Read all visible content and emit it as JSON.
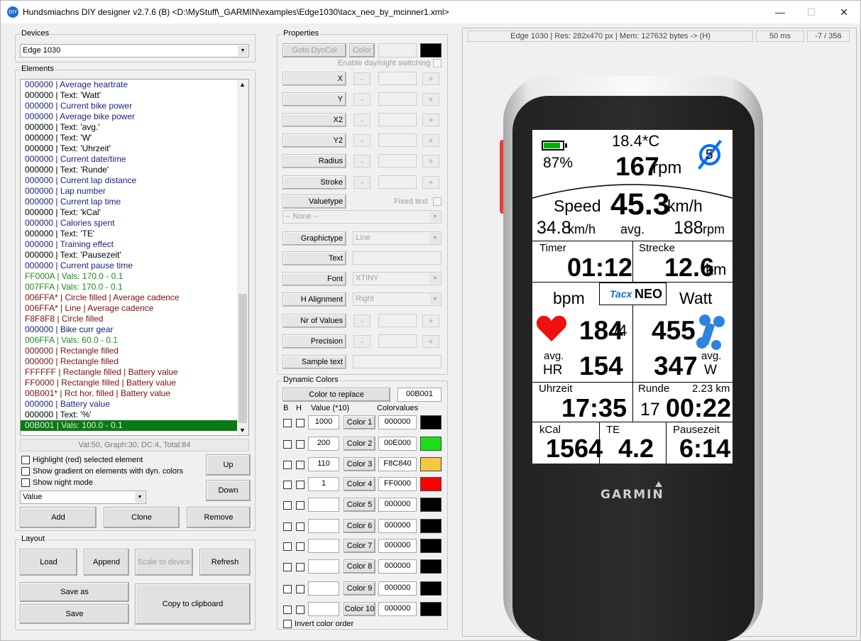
{
  "window": {
    "title": "Hundsmiachns DIY designer v2.7.6 (B) <D:\\MyStuff\\_GARMIN\\examples\\Edge1030\\tacx_neo_by_mcinner1.xml>",
    "icon": "app-icon",
    "min": "—",
    "max": "☐",
    "close": "✕"
  },
  "devices": {
    "label": "Devices",
    "selected": "Edge 1030"
  },
  "elements": {
    "label": "Elements",
    "items": [
      {
        "t": "000000 | Average heartrate",
        "c": "#1a237e"
      },
      {
        "t": "000000 | Text: 'Watt'",
        "c": "#000000"
      },
      {
        "t": "000000 | Current bike power",
        "c": "#1a237e"
      },
      {
        "t": "000000 | Average bike power",
        "c": "#1a237e"
      },
      {
        "t": "000000 | Text: 'avg.'",
        "c": "#000000"
      },
      {
        "t": "000000 | Text: 'W'",
        "c": "#000000"
      },
      {
        "t": "000000 | Text: 'Uhrzeit'",
        "c": "#000000"
      },
      {
        "t": "000000 | Current date/time",
        "c": "#1a237e"
      },
      {
        "t": "000000 | Text: 'Runde'",
        "c": "#000000"
      },
      {
        "t": "000000 | Current lap distance",
        "c": "#1a237e"
      },
      {
        "t": "000000 | Lap number",
        "c": "#1a237e"
      },
      {
        "t": "000000 | Current lap time",
        "c": "#1a237e"
      },
      {
        "t": "000000 | Text: 'kCal'",
        "c": "#000000"
      },
      {
        "t": "000000 | Calories spent",
        "c": "#1a237e"
      },
      {
        "t": "000000 | Text: 'TE'",
        "c": "#000000"
      },
      {
        "t": "000000 | Training effect",
        "c": "#1a237e"
      },
      {
        "t": "000000 | Text: 'Pausezeit'",
        "c": "#000000"
      },
      {
        "t": "000000 | Current pause time",
        "c": "#1a237e"
      },
      {
        "t": "FF000A | Vals: 170.0 - 0.1",
        "c": "#1b8a1b"
      },
      {
        "t": "007FFA | Vals: 170.0 - 0.1",
        "c": "#1b8a1b"
      },
      {
        "t": "006FFA* | Circle filled | Average cadence",
        "c": "#7b1010"
      },
      {
        "t": "006FFA* | Line | Average cadence",
        "c": "#7b1010"
      },
      {
        "t": "F8F8F8 | Circle filled",
        "c": "#7b1010"
      },
      {
        "t": "000000 | Bike curr gear",
        "c": "#1a237e"
      },
      {
        "t": "006FFA | Vals: 60.0 - 0.1",
        "c": "#1b8a1b"
      },
      {
        "t": "000000 | Rectangle filled",
        "c": "#7b1010"
      },
      {
        "t": "000000 | Rectangle filled",
        "c": "#7b1010"
      },
      {
        "t": "FFFFFF | Rectangle filled | Battery value",
        "c": "#7b1010"
      },
      {
        "t": "FF0000 | Rectangle filled | Battery value",
        "c": "#7b1010"
      },
      {
        "t": "00B001* | Rct hor. filled | Battery value",
        "c": "#7b1010"
      },
      {
        "t": "000000 | Battery value",
        "c": "#1a237e"
      },
      {
        "t": "000000 | Text: '%'",
        "c": "#000000"
      },
      {
        "t": "00B001 | Vals: 100.0 - 0.1",
        "c": "#e8e8e8"
      }
    ],
    "summary": "Val:50, Graph:30, DC:4, Total:84",
    "opt_highlight": "Highlight (red) selected element",
    "opt_gradient": "Show gradient on elements with dyn. colors",
    "opt_night": "Show night mode",
    "up": "Up",
    "down": "Down",
    "type_select": "Value",
    "add": "Add",
    "clone": "Clone",
    "remove": "Remove"
  },
  "layout": {
    "label": "Layout",
    "load": "Load",
    "append": "Append",
    "scale": "Scale to device",
    "refresh": "Refresh",
    "save_as": "Save as",
    "save": "Save",
    "copy": "Copy to clipboard"
  },
  "properties": {
    "label": "Properties",
    "goto": "Goto DynCol",
    "color": "Color",
    "daynight": "Enable day/night switching",
    "rows": [
      "X",
      "Y",
      "X2",
      "Y2",
      "Radius",
      "Stroke"
    ],
    "valuetype": "Valuetype",
    "fixedtext": "Fixed text",
    "none": "-- None --",
    "graphictype": "Graphictype",
    "graphic_val": "Line",
    "text": "Text",
    "font": "Font",
    "font_val": "XTINY",
    "halign": "H Alignment",
    "halign_val": "Right",
    "nrvals": "Nr of Values",
    "precision": "Precision",
    "sample": "Sample text",
    "minus": "-",
    "plus": "+"
  },
  "dyncolors": {
    "label": "Dynamic Colors",
    "replace_btn": "Color to replace",
    "replace_val": "00B001",
    "hdr_b": "B",
    "hdr_h": "H",
    "hdr_value": "Value (*10)",
    "hdr_colorvalues": "Colorvalues",
    "rows": [
      {
        "v": "1000",
        "btn": "Color 1",
        "hex": "000000",
        "sw": "#000000"
      },
      {
        "v": "200",
        "btn": "Color 2",
        "hex": "00E000",
        "sw": "#19e019"
      },
      {
        "v": "110",
        "btn": "Color 3",
        "hex": "F8C840",
        "sw": "#f8c840"
      },
      {
        "v": "1",
        "btn": "Color 4",
        "hex": "FF0000",
        "sw": "#ff0000"
      },
      {
        "v": "",
        "btn": "Color 5",
        "hex": "000000",
        "sw": "#000000"
      },
      {
        "v": "",
        "btn": "Color 6",
        "hex": "000000",
        "sw": "#000000"
      },
      {
        "v": "",
        "btn": "Color 7",
        "hex": "000000",
        "sw": "#000000"
      },
      {
        "v": "",
        "btn": "Color 8",
        "hex": "000000",
        "sw": "#000000"
      },
      {
        "v": "",
        "btn": "Color 9",
        "hex": "000000",
        "sw": "#000000"
      },
      {
        "v": "",
        "btn": "Color 10",
        "hex": "000000",
        "sw": "#000000"
      }
    ],
    "invert": "Invert color order"
  },
  "status": {
    "device": "Edge 1030 | Res: 282x470 px | Mem: 127632 bytes -> (H)",
    "time": "50 ms",
    "pos": "-7 / 356"
  },
  "preview": {
    "brand": "GARMIN",
    "battery_pct": 0.87,
    "temp": "18.4*C",
    "battery": "87%",
    "cadence": "167",
    "rpm": "rpm",
    "gear": "5",
    "speed_lbl": "Speed",
    "speed": "45.3",
    "kmh": "km/h",
    "avg_speed": "34.8",
    "kmh2": "km/h",
    "avg": "avg.",
    "avg_cad": "188",
    "rpm2": "rpm",
    "timer_lbl": "Timer",
    "timer": "01:12",
    "strecke_lbl": "Strecke",
    "dist": "12.6",
    "km": "km",
    "bpm": "bpm",
    "tacx": "Tacx",
    "neo": "NEO",
    "watt": "Watt",
    "hr": "184",
    "hr_zone": "/4",
    "power": "455",
    "avg1": "avg.",
    "hr_lbl": "HR",
    "avg_hr": "154",
    "avg_power": "347",
    "avg2": "avg.",
    "w": "W",
    "uhrzeit_lbl": "Uhrzeit",
    "clock": "17:35",
    "runde_lbl": "Runde",
    "lap_dist": "2.23 km",
    "lap": "17",
    "lap_time": "00:22",
    "kcal_lbl": "kCal",
    "kcal": "1564",
    "te_lbl": "TE",
    "te": "4.2",
    "pause_lbl": "Pausezeit",
    "pause": "6:14"
  }
}
